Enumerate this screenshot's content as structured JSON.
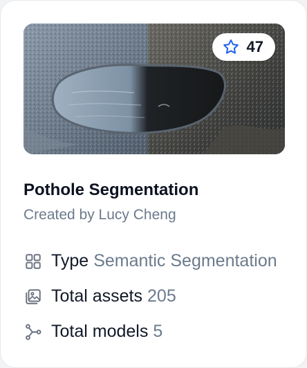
{
  "card": {
    "stars": "47",
    "title": "Pothole Segmentation",
    "created_by": "Created by Lucy Cheng",
    "meta": {
      "type_label": "Type",
      "type_value": "Semantic Segmentation",
      "assets_label": "Total assets",
      "assets_value": "205",
      "models_label": "Total models",
      "models_value": "5"
    },
    "icons": {
      "star": "star-outline-icon",
      "type": "grid-icon",
      "assets": "image-gallery-icon",
      "models": "model-graph-icon"
    },
    "colors": {
      "accent": "#2563eb",
      "title": "#0b1120",
      "muted": "#6b7a8c"
    }
  }
}
